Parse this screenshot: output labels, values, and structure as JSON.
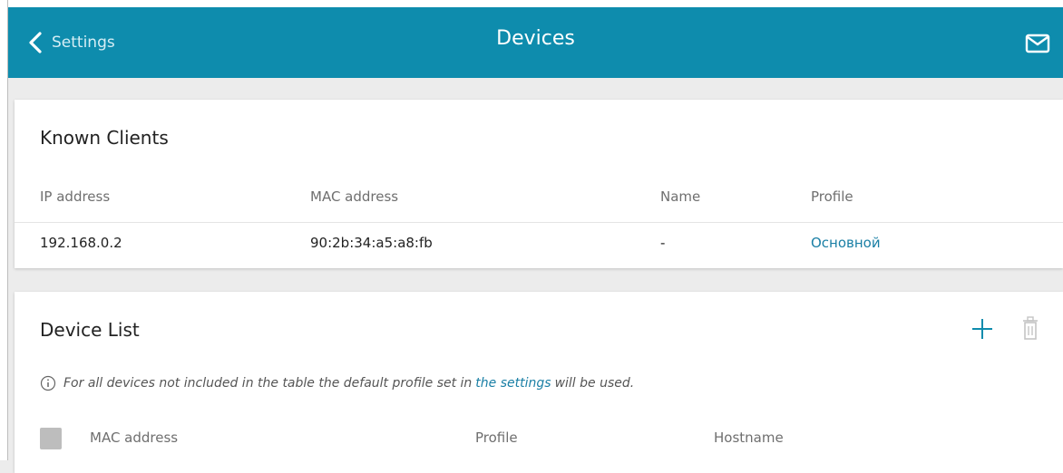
{
  "header": {
    "back_label": "Settings",
    "title": "Devices",
    "mail_icon": "envelope-icon",
    "color": "#0e8cad"
  },
  "known_clients": {
    "title": "Known Clients",
    "columns": [
      "IP address",
      "MAC address",
      "Name",
      "Profile"
    ],
    "rows": [
      {
        "ip": "192.168.0.2",
        "mac": "90:2b:34:a5:a8:fb",
        "name": "-",
        "profile": "Основной"
      }
    ]
  },
  "device_list": {
    "title": "Device List",
    "add_icon": "plus-icon",
    "delete_icon": "trash-icon",
    "info_prefix": "For all devices not included in the table the default profile set in",
    "info_link": "the settings",
    "info_suffix": "will be used.",
    "columns": [
      "MAC address",
      "Profile",
      "Hostname"
    ]
  },
  "accent_link_color": "#1a7fa5"
}
